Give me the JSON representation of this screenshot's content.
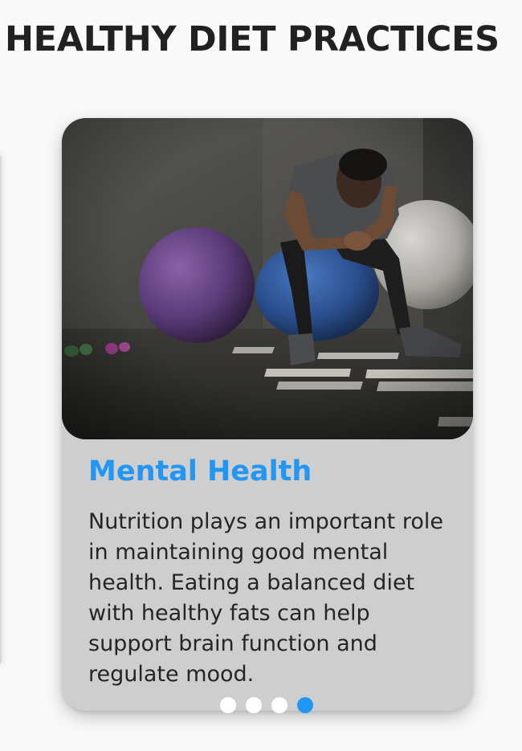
{
  "header": {
    "title": "HEALTHY DIET PRACTICES"
  },
  "carousel": {
    "active_index": 3,
    "slide_count": 4,
    "card": {
      "image_alt": "man sitting on exercise ball in gym",
      "title": "Mental Health",
      "body": "Nutrition plays an important role in maintaining good mental health. Eating a balanced diet with healthy fats can help support brain function and regulate mood."
    }
  },
  "colors": {
    "accent": "#2196f3",
    "card_bg": "#cecece",
    "page_bg": "#f9f9f9",
    "title_text": "#212121"
  }
}
